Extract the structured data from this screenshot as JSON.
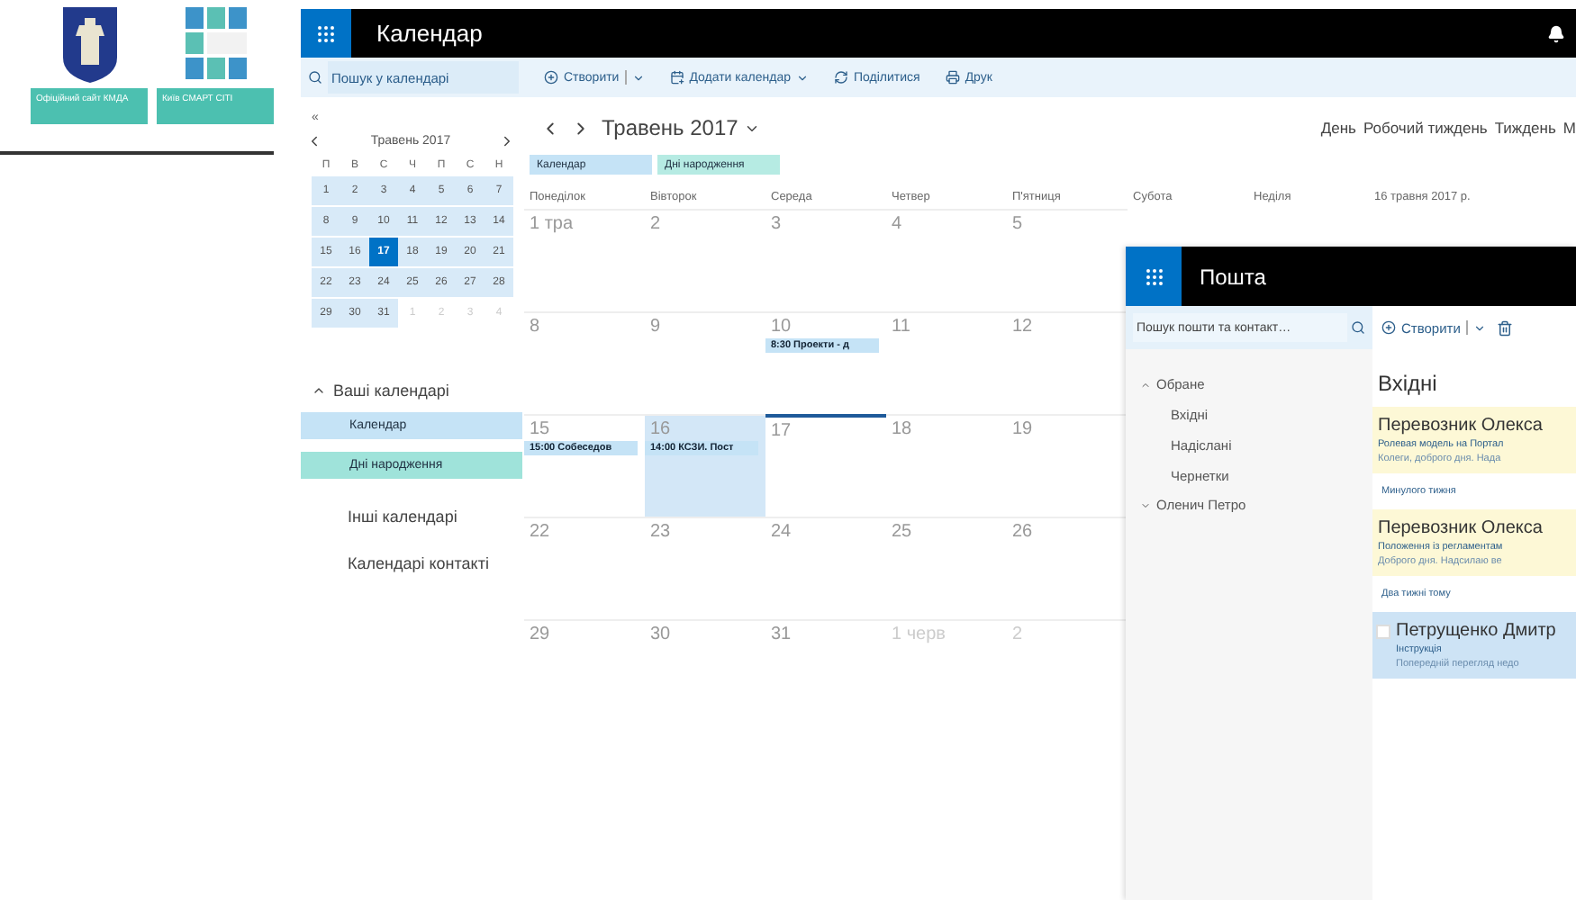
{
  "tiles": [
    {
      "kind": "crest",
      "label": "Офіційний сайт КМДА"
    },
    {
      "kind": "smart",
      "label": "Київ СМАРТ СІТІ"
    }
  ],
  "app": {
    "title": "Календар"
  },
  "search": {
    "placeholder": "Пошук у календарі"
  },
  "toolbar": [
    {
      "kind": "create",
      "label": "Створити"
    },
    {
      "kind": "add",
      "label": "Додати календар"
    },
    {
      "kind": "share",
      "label": "Поділитися"
    },
    {
      "kind": "print",
      "label": "Друк"
    }
  ],
  "mini_calendar": {
    "collapse": "«",
    "month": "Травень 2017",
    "weekdays": [
      "П",
      "В",
      "С",
      "Ч",
      "П",
      "С",
      "Н"
    ],
    "weeks": [
      [
        {
          "d": "1",
          "muted": false,
          "selected": false
        },
        {
          "d": "2",
          "muted": false,
          "selected": false
        },
        {
          "d": "3",
          "muted": false,
          "selected": false
        },
        {
          "d": "4",
          "muted": false,
          "selected": false
        },
        {
          "d": "5",
          "muted": false,
          "selected": false
        },
        {
          "d": "6",
          "muted": false,
          "selected": false
        },
        {
          "d": "7",
          "muted": false,
          "selected": false
        }
      ],
      [
        {
          "d": "8",
          "muted": false,
          "selected": false
        },
        {
          "d": "9",
          "muted": false,
          "selected": false
        },
        {
          "d": "10",
          "muted": false,
          "selected": false
        },
        {
          "d": "11",
          "muted": false,
          "selected": false
        },
        {
          "d": "12",
          "muted": false,
          "selected": false
        },
        {
          "d": "13",
          "muted": false,
          "selected": false
        },
        {
          "d": "14",
          "muted": false,
          "selected": false
        }
      ],
      [
        {
          "d": "15",
          "muted": false,
          "selected": false
        },
        {
          "d": "16",
          "muted": false,
          "selected": false
        },
        {
          "d": "17",
          "muted": false,
          "selected": true
        },
        {
          "d": "18",
          "muted": false,
          "selected": false
        },
        {
          "d": "19",
          "muted": false,
          "selected": false
        },
        {
          "d": "20",
          "muted": false,
          "selected": false
        },
        {
          "d": "21",
          "muted": false,
          "selected": false
        }
      ],
      [
        {
          "d": "22",
          "muted": false,
          "selected": false
        },
        {
          "d": "23",
          "muted": false,
          "selected": false
        },
        {
          "d": "24",
          "muted": false,
          "selected": false
        },
        {
          "d": "25",
          "muted": false,
          "selected": false
        },
        {
          "d": "26",
          "muted": false,
          "selected": false
        },
        {
          "d": "27",
          "muted": false,
          "selected": false
        },
        {
          "d": "28",
          "muted": false,
          "selected": false
        }
      ],
      [
        {
          "d": "29",
          "muted": false,
          "selected": false
        },
        {
          "d": "30",
          "muted": false,
          "selected": false
        },
        {
          "d": "31",
          "muted": false,
          "selected": false
        },
        {
          "d": "1",
          "muted": true,
          "selected": false
        },
        {
          "d": "2",
          "muted": true,
          "selected": false
        },
        {
          "d": "3",
          "muted": true,
          "selected": false
        },
        {
          "d": "4",
          "muted": true,
          "selected": false
        }
      ]
    ]
  },
  "calendars": {
    "section": "Ваші календарі",
    "expanded": true,
    "items": [
      {
        "label": "Календар",
        "color": "#c5e3f6"
      },
      {
        "label": "Дні народження",
        "color": "#9fe3da"
      }
    ],
    "others": [
      "Інші календарі",
      "Календарі контакті"
    ]
  },
  "main": {
    "month": "Травень 2017",
    "views": [
      "День",
      "Робочий тиждень",
      "Тиждень",
      "М"
    ],
    "tags": [
      {
        "label": "Календар",
        "color": "#c5e3f6"
      },
      {
        "label": "Дні народження",
        "color": "#b6ebe3"
      }
    ],
    "weekdays": [
      "Понеділок",
      "Вівторок",
      "Середа",
      "Четвер",
      "П'ятниця",
      "Субота",
      "Неділя"
    ],
    "date_label": "16 травня 2017 р.",
    "weeks": [
      [
        {
          "d": "1 тра",
          "muted": false,
          "selected": false,
          "today": false
        },
        {
          "d": "2",
          "muted": false,
          "selected": false,
          "today": false
        },
        {
          "d": "3",
          "muted": false,
          "selected": false,
          "today": false
        },
        {
          "d": "4",
          "muted": false,
          "selected": false,
          "today": false
        },
        {
          "d": "5",
          "muted": false,
          "selected": false,
          "today": false
        }
      ],
      [
        {
          "d": "8",
          "muted": false,
          "selected": false,
          "today": false
        },
        {
          "d": "9",
          "muted": false,
          "selected": false,
          "today": false
        },
        {
          "d": "10",
          "muted": false,
          "selected": false,
          "today": false,
          "event": "8:30 Проекти - д"
        },
        {
          "d": "11",
          "muted": false,
          "selected": false,
          "today": false
        },
        {
          "d": "12",
          "muted": false,
          "selected": false,
          "today": false
        }
      ],
      [
        {
          "d": "15",
          "muted": false,
          "selected": false,
          "today": false,
          "event": "15:00 Собеседов"
        },
        {
          "d": "16",
          "muted": false,
          "selected": true,
          "today": false,
          "event": "14:00 КСЗИ. Пост"
        },
        {
          "d": "17",
          "muted": false,
          "selected": false,
          "today": true
        },
        {
          "d": "18",
          "muted": false,
          "selected": false,
          "today": false
        },
        {
          "d": "19",
          "muted": false,
          "selected": false,
          "today": false
        }
      ],
      [
        {
          "d": "22",
          "muted": false,
          "selected": false,
          "today": false
        },
        {
          "d": "23",
          "muted": false,
          "selected": false,
          "today": false
        },
        {
          "d": "24",
          "muted": false,
          "selected": false,
          "today": false
        },
        {
          "d": "25",
          "muted": false,
          "selected": false,
          "today": false
        },
        {
          "d": "26",
          "muted": false,
          "selected": false,
          "today": false
        }
      ],
      [
        {
          "d": "29",
          "muted": false,
          "selected": false,
          "today": false
        },
        {
          "d": "30",
          "muted": false,
          "selected": false,
          "today": false
        },
        {
          "d": "31",
          "muted": false,
          "selected": false,
          "today": false
        },
        {
          "d": "1 черв",
          "muted": true,
          "selected": false,
          "today": false
        },
        {
          "d": "2",
          "muted": true,
          "selected": false,
          "today": false
        }
      ]
    ]
  },
  "mail": {
    "title": "Пошта",
    "search": {
      "placeholder": "Пошук пошти та контакт…"
    },
    "folders": [
      {
        "label": "Обране",
        "expanded": true,
        "children": [
          {
            "label": "Вхідні"
          },
          {
            "label": "Надіслані"
          },
          {
            "label": "Чернетки"
          }
        ]
      },
      {
        "label": "Оленич Петро",
        "expanded": false
      }
    ],
    "new_button": "Створити",
    "heading": "Вхідні",
    "items": [
      {
        "kind": "message",
        "sender": "Перевозник Олекса",
        "subject": "Ролевая модель на Портал",
        "preview": "Колеги, доброго дня.  Нада",
        "flagged": true,
        "selected": false
      },
      {
        "kind": "group",
        "label": "Минулого тижня"
      },
      {
        "kind": "message",
        "sender": "Перевозник Олекса",
        "subject": "Положення із регламентам",
        "preview": "Доброго дня.  Надсилаю ве",
        "flagged": true,
        "selected": false
      },
      {
        "kind": "group",
        "label": "Два тижні тому"
      },
      {
        "kind": "message",
        "sender": "Петрущенко Дмитр",
        "subject": "Інструкція",
        "preview": "Попередній перегляд недо",
        "flagged": false,
        "selected": true
      }
    ]
  }
}
